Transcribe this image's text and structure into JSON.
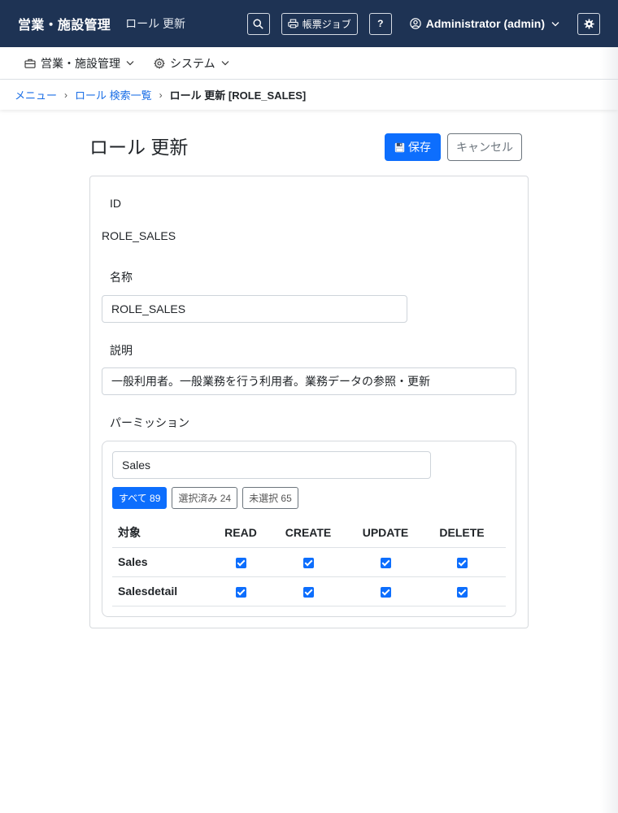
{
  "header": {
    "brand": "営業・施設管理",
    "page_subtitle": "ロール 更新",
    "print_jobs_label": "帳票ジョブ",
    "help_label": "?",
    "user_label": "Administrator (admin)"
  },
  "nav": {
    "items": [
      {
        "label": "営業・施設管理",
        "icon": "briefcase-icon"
      },
      {
        "label": "システム",
        "icon": "gear-icon"
      }
    ]
  },
  "breadcrumb": {
    "items": [
      "メニュー",
      "ロール 検索一覧"
    ],
    "current": "ロール 更新 [ROLE_SALES]"
  },
  "page": {
    "title": "ロール 更新",
    "save_label": "保存",
    "cancel_label": "キャンセル"
  },
  "form": {
    "id_label": "ID",
    "id_value": "ROLE_SALES",
    "name_label": "名称",
    "name_value": "ROLE_SALES",
    "desc_label": "説明",
    "desc_value": "一般利用者。一般業務を行う利用者。業務データの参照・更新",
    "perm_label": "パーミッション"
  },
  "permissions": {
    "filter_value": "Sales",
    "chips": {
      "all": "すべて 89",
      "selected": "選択済み 24",
      "unselected": "未選択 65"
    },
    "columns": [
      "対象",
      "READ",
      "CREATE",
      "UPDATE",
      "DELETE"
    ],
    "rows": [
      {
        "name": "Sales",
        "read": true,
        "create": true,
        "update": true,
        "delete": true
      },
      {
        "name": "Salesdetail",
        "read": true,
        "create": true,
        "update": true,
        "delete": true
      }
    ]
  },
  "colors": {
    "header_bg": "#1e3354",
    "primary": "#0d6efd",
    "link": "#1a6ee6"
  }
}
